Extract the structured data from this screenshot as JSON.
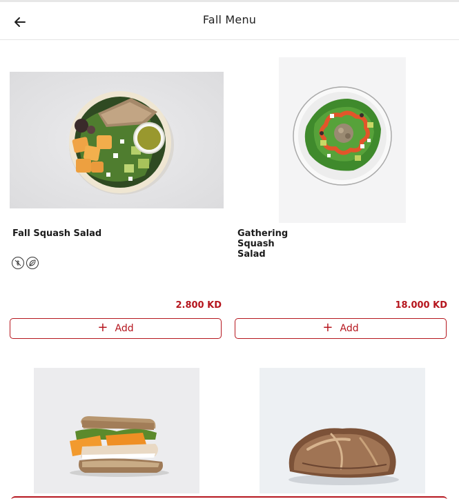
{
  "header": {
    "title": "Fall Menu"
  },
  "icons": {
    "back": "arrow-left-icon",
    "diet_1": "no-gluten-icon",
    "diet_2": "leaf-icon",
    "add": "plus-icon"
  },
  "colors": {
    "accent": "#b5151d",
    "divider": "#e4e4e4"
  },
  "items": [
    {
      "name": "Fall Squash Salad",
      "price": "2.800 KD",
      "add_label": "Add",
      "image": "squash-salad-bowl-image"
    },
    {
      "name": "Gathering Squash Salad",
      "price": "18.000 KD",
      "add_label": "Add",
      "image": "squash-salad-platter-image"
    },
    {
      "image": "squash-sandwich-image"
    },
    {
      "image": "sourdough-bread-image"
    }
  ]
}
